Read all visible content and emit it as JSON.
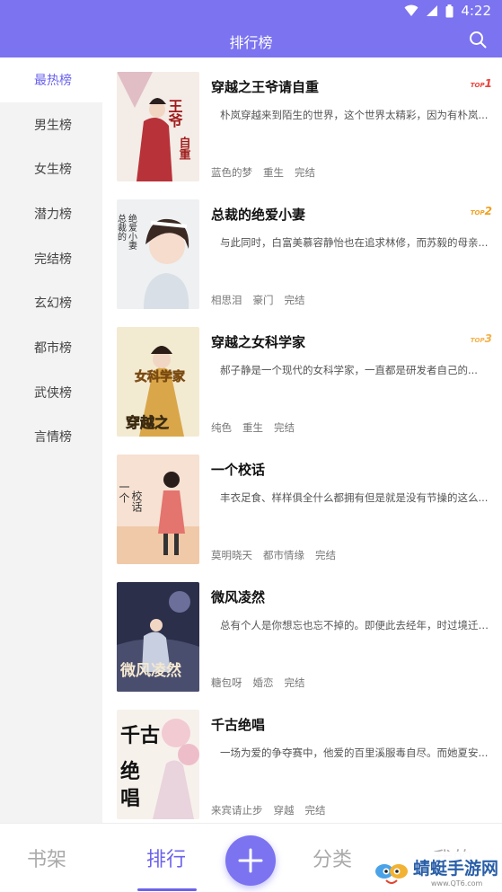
{
  "status": {
    "time": "4:22"
  },
  "header": {
    "title": "排行榜"
  },
  "sidebar": {
    "items": [
      {
        "label": "最热榜",
        "active": true
      },
      {
        "label": "男生榜"
      },
      {
        "label": "女生榜"
      },
      {
        "label": "潜力榜"
      },
      {
        "label": "完结榜"
      },
      {
        "label": "玄幻榜"
      },
      {
        "label": "都市榜"
      },
      {
        "label": "武侠榜"
      },
      {
        "label": "言情榜"
      }
    ]
  },
  "books": [
    {
      "title": "穿越之王爷请自重",
      "desc": "朴岚穿越来到陌生的世界，这个世界太精彩，因为有朴岚...",
      "tags": [
        "蓝色的梦",
        "重生",
        "完结"
      ],
      "badge": {
        "prefix": "TOP",
        "num": "1",
        "color": "#e8413a"
      },
      "cover_text": "王爷请自重"
    },
    {
      "title": "总裁的绝爱小妻",
      "desc": "与此同时，白富美慕容静怡也在追求林修，而苏毅的母亲...",
      "tags": [
        "相思泪",
        "豪门",
        "完结"
      ],
      "badge": {
        "prefix": "TOP",
        "num": "2",
        "color": "#f0a020"
      },
      "cover_text": "总裁的绝爱小妻"
    },
    {
      "title": "穿越之女科学家",
      "desc": "郝子静是一个现代的女科学家，一直都是研发者自己的...",
      "tags": [
        "纯色",
        "重生",
        "完结"
      ],
      "badge": {
        "prefix": "TOP",
        "num": "3",
        "color": "#f2b24a"
      },
      "cover_text": "女科学家 穿越之"
    },
    {
      "title": "一个校话",
      "desc": "丰衣足食、样样俱全什么都拥有但是就是没有节操的这么...",
      "tags": [
        "莫明晓天",
        "都市情缘",
        "完结"
      ],
      "cover_text": "一个校话"
    },
    {
      "title": "微风凌然",
      "desc": "总有个人是你想忘也忘不掉的。即便此去经年，时过境迁。...",
      "tags": [
        "糖包呀",
        "婚恋",
        "完结"
      ],
      "cover_text": "微风凌然"
    },
    {
      "title": "千古绝唱",
      "desc": "一场为爱的争夺赛中，他爱的百里溪服毒自尽。而她夏安...",
      "tags": [
        "来宾请止步",
        "穿越",
        "完结"
      ],
      "cover_text": "千古绝唱"
    }
  ],
  "tabs": [
    {
      "label": "书架"
    },
    {
      "label": "排行",
      "active": true
    },
    {
      "label": "分类"
    },
    {
      "label": "我的"
    }
  ],
  "watermark": {
    "name": "蜻蜓手游网",
    "url": "www.QT6.com"
  },
  "colors": {
    "accent": "#7b73f0",
    "active_text": "#6b63ec"
  }
}
